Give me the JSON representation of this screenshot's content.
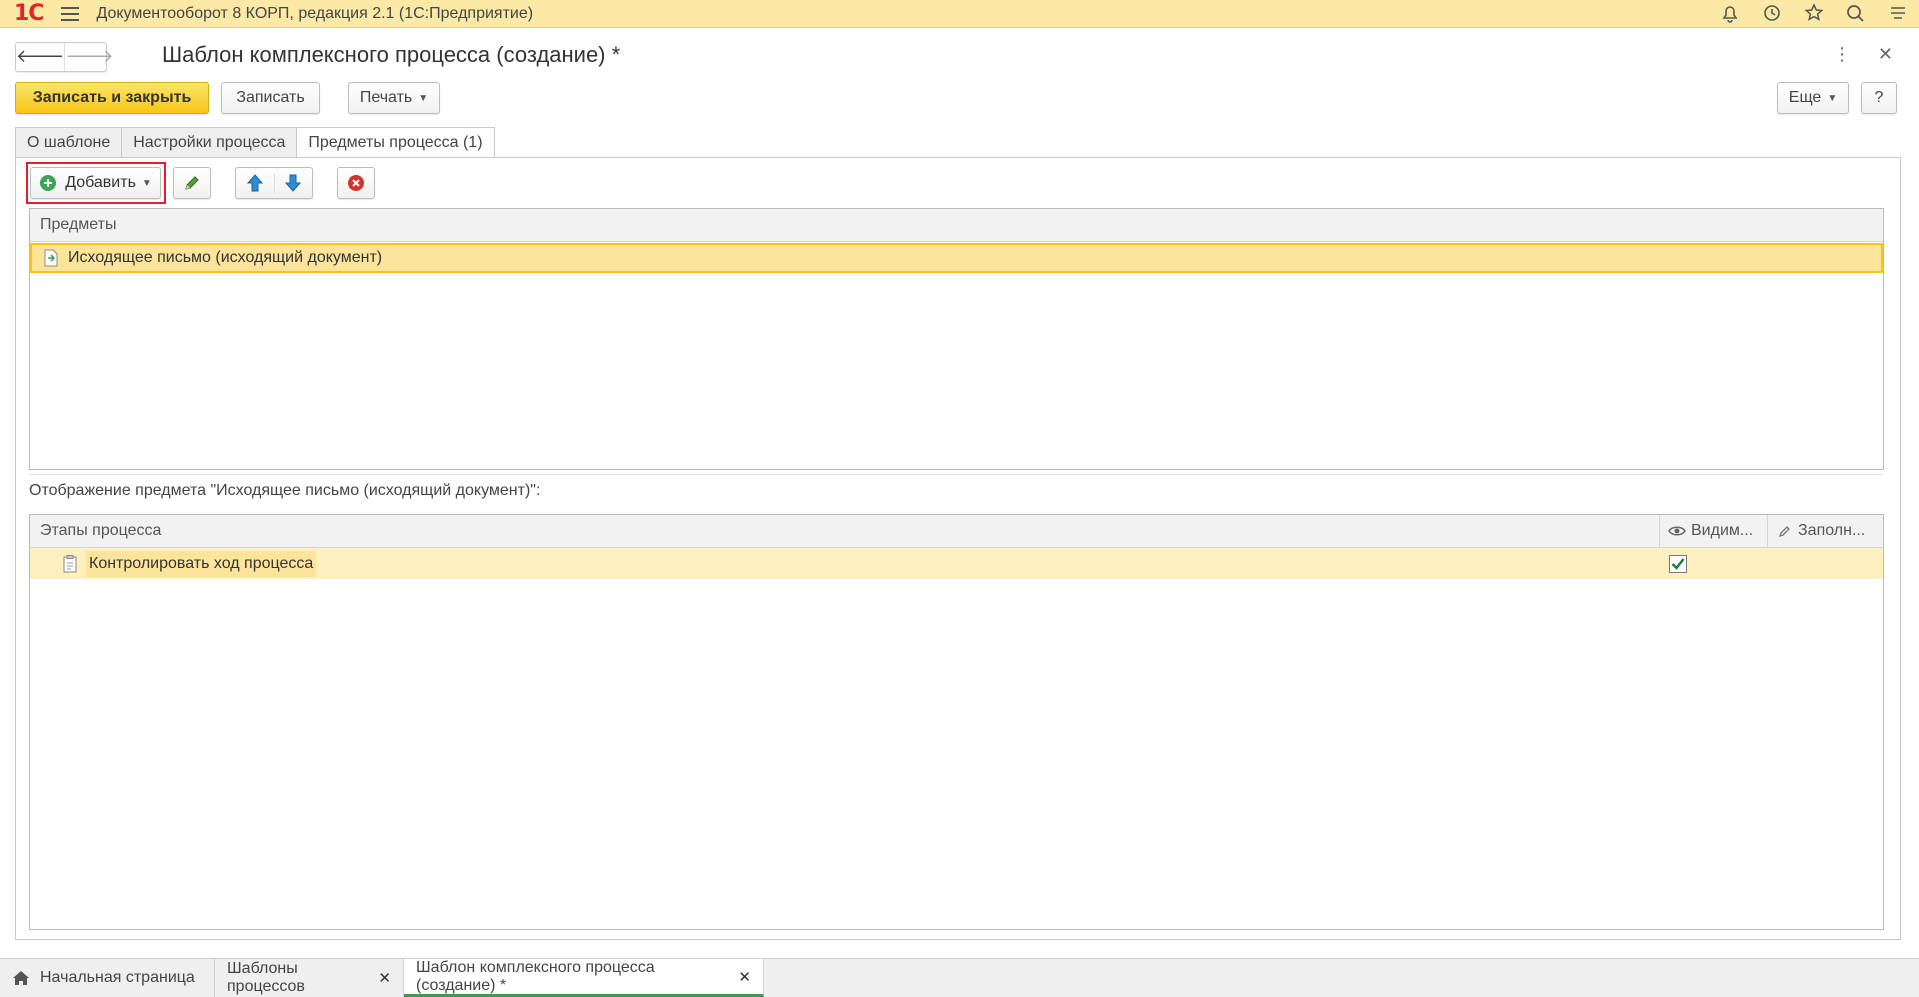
{
  "app": {
    "logo": "1С",
    "title": "Документооборот 8 КОРП, редакция 2.1  (1С:Предприятие)"
  },
  "form": {
    "title": "Шаблон комплексного процесса (создание) *"
  },
  "toolbar": {
    "save_close": "Записать и закрыть",
    "save": "Записать",
    "print": "Печать",
    "more": "Еще",
    "help": "?"
  },
  "tabs": [
    {
      "label": "О шаблоне"
    },
    {
      "label": "Настройки процесса"
    },
    {
      "label": "Предметы процесса (1)"
    }
  ],
  "subjects_toolbar": {
    "add": "Добавить"
  },
  "subjects_table": {
    "header": "Предметы",
    "rows": [
      {
        "label": "Исходящее письмо (исходящий документ)"
      }
    ]
  },
  "display_caption": "Отображение предмета \"Исходящее письмо (исходящий документ)\":",
  "stages_table": {
    "col_stages": "Этапы процесса",
    "col_visible": "Видим...",
    "col_fill": "Заполн...",
    "rows": [
      {
        "label": "Контролировать ход процесса",
        "visible": true
      }
    ]
  },
  "bottom_tabs": [
    {
      "label": "Начальная страница"
    },
    {
      "label": "Шаблоны процессов"
    },
    {
      "label": "Шаблон комплексного процесса (создание) *"
    }
  ],
  "colors": {
    "accent": "#f6c615",
    "title_bar": "#fbe9a5",
    "selection": "#fce59a",
    "highlight_frame": "#e0202a"
  }
}
